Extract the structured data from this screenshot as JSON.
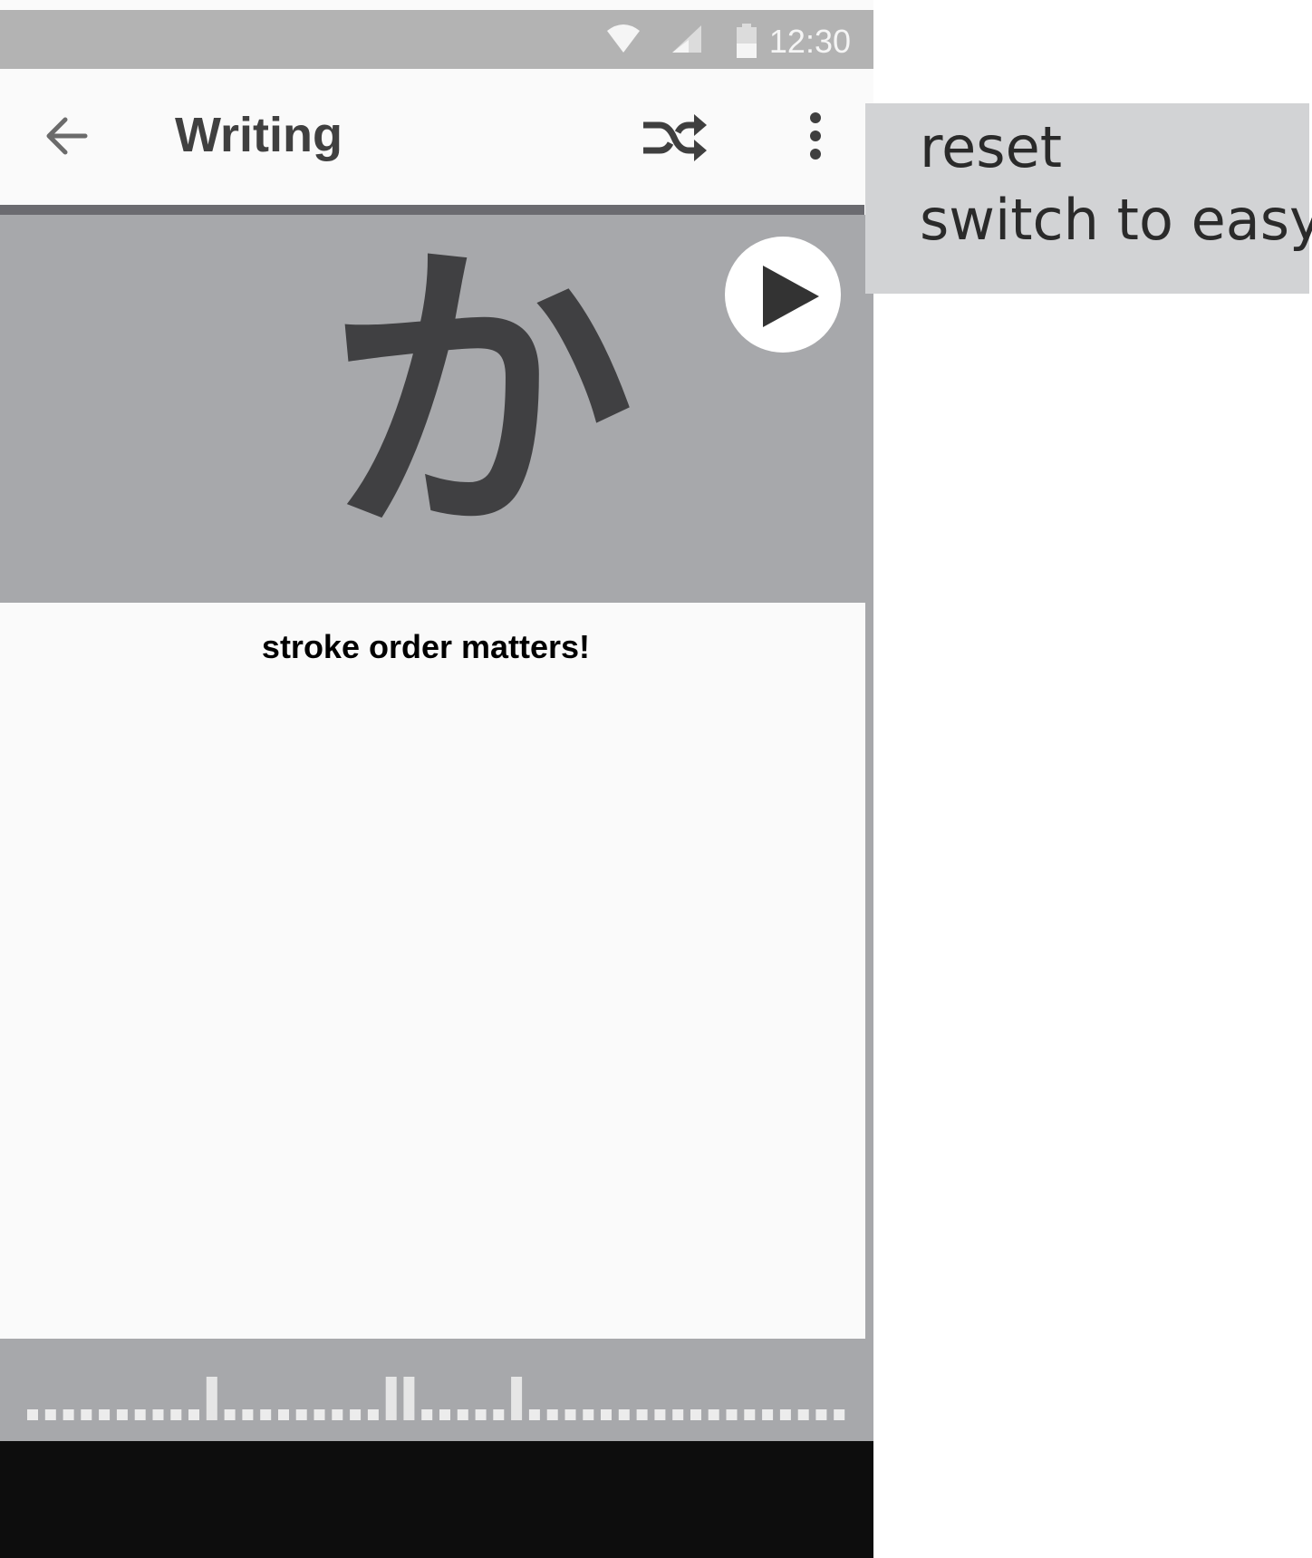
{
  "status_bar": {
    "time": "12:30",
    "icons": [
      "wifi-icon",
      "cell-signal-icon",
      "battery-icon"
    ]
  },
  "app_bar": {
    "title": "Writing",
    "icons": [
      "back-arrow-icon",
      "shuffle-icon",
      "more-vert-icon"
    ]
  },
  "character": {
    "kana": "か",
    "play_icon": "play-icon"
  },
  "writing": {
    "hint": "stroke order matters!"
  },
  "overflow_menu": {
    "items": [
      {
        "label": "reset"
      },
      {
        "label": "switch to easy"
      }
    ]
  },
  "progress": {
    "total_items": 46,
    "highlighted_indices": [
      10,
      20,
      21,
      27
    ]
  },
  "colors": {
    "status_bar": "#b3b3b3",
    "app_bar": "#fafafa",
    "character_panel": "#a7a8ab",
    "menu": "#d2d3d5",
    "nav_bar": "#0d0d0d"
  }
}
